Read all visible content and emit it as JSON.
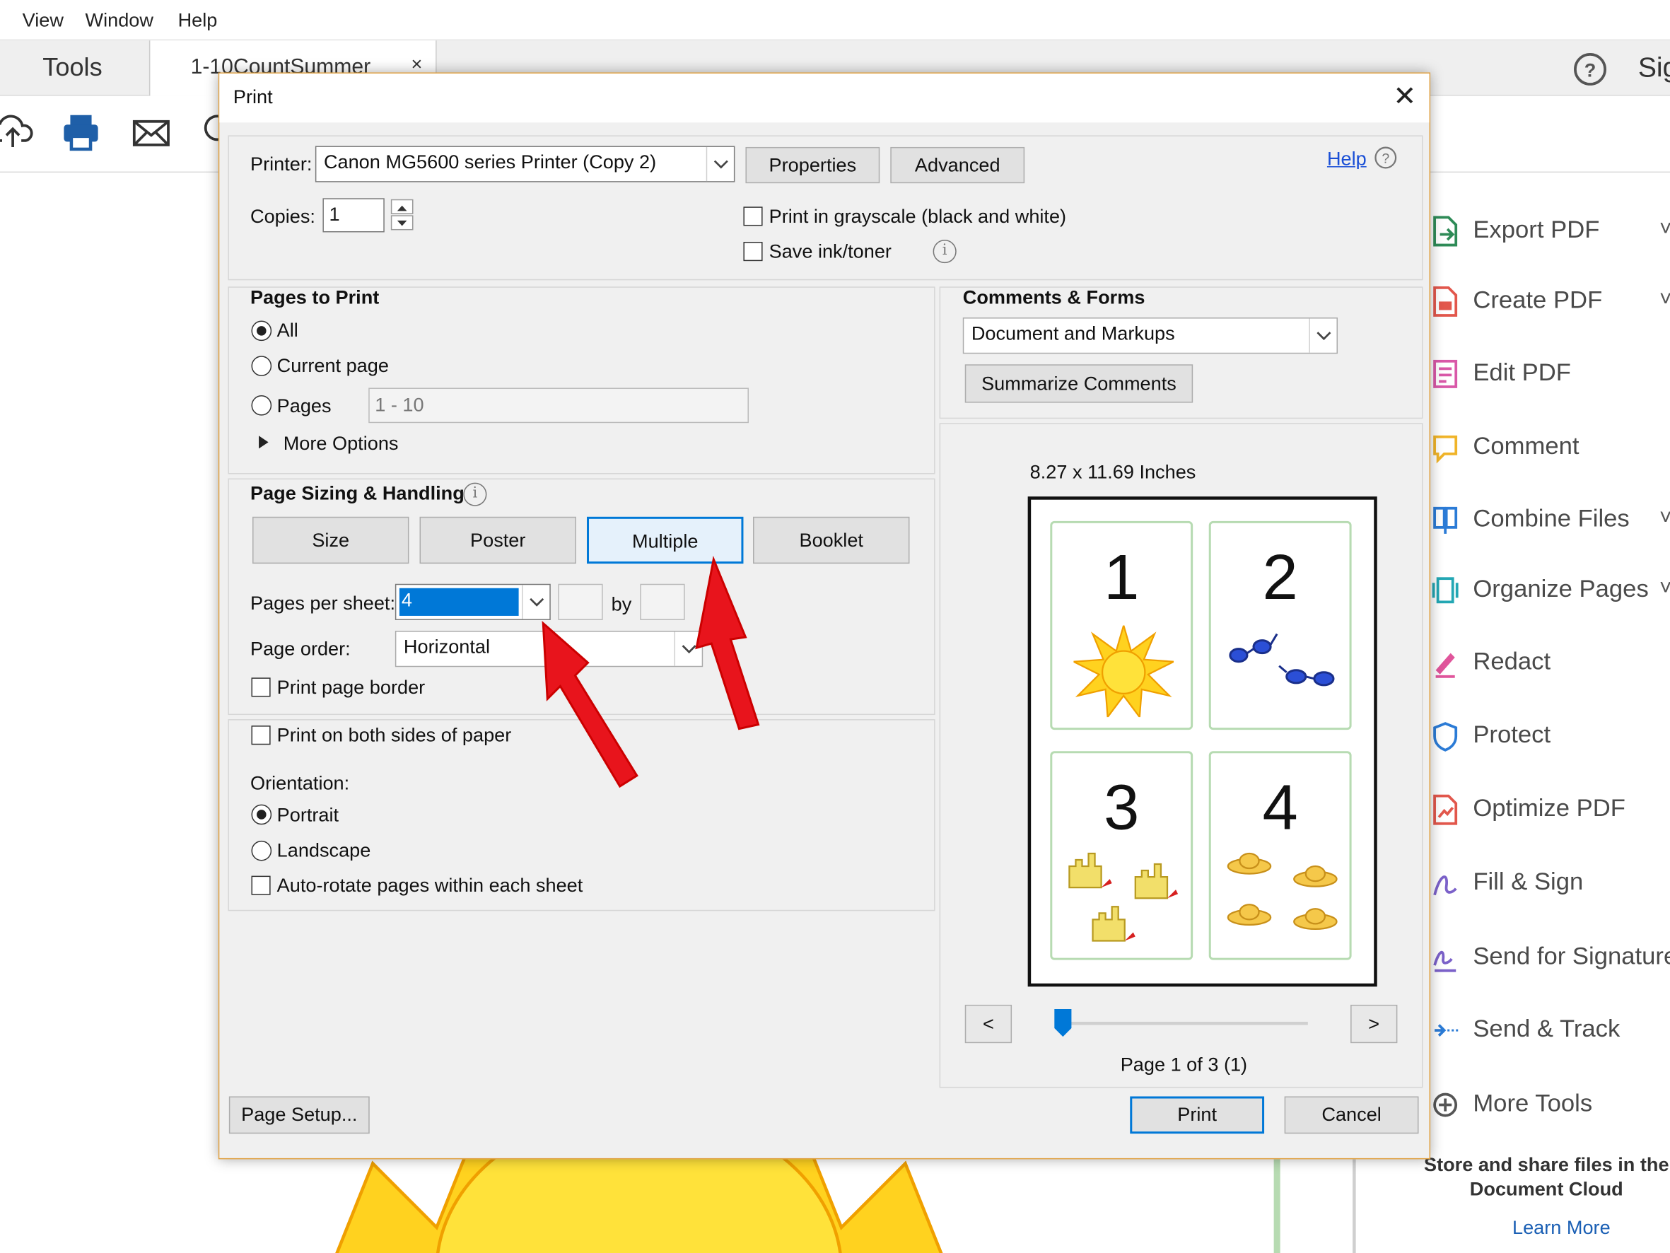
{
  "menubar": {
    "items": [
      "View",
      "Window",
      "Help"
    ]
  },
  "tabs": {
    "tools": "Tools",
    "document": "1-10CountSummer",
    "close": "×",
    "sign": "Sig"
  },
  "right_pane": {
    "items": [
      {
        "label": "Export PDF",
        "icon": "export-pdf-icon",
        "color": "#2e8b57",
        "chevron": "˅"
      },
      {
        "label": "Create PDF",
        "icon": "create-pdf-icon",
        "color": "#e2574c",
        "chevron": "˅"
      },
      {
        "label": "Edit PDF",
        "icon": "edit-pdf-icon",
        "color": "#d958a8",
        "chevron": ""
      },
      {
        "label": "Comment",
        "icon": "comment-icon",
        "color": "#f0b429",
        "chevron": ""
      },
      {
        "label": "Combine Files",
        "icon": "combine-files-icon",
        "color": "#2b7bd6",
        "chevron": "˅"
      },
      {
        "label": "Organize Pages",
        "icon": "organize-pages-icon",
        "color": "#23a7b4",
        "chevron": "˅"
      },
      {
        "label": "Redact",
        "icon": "redact-icon",
        "color": "#e0559b",
        "chevron": ""
      },
      {
        "label": "Protect",
        "icon": "protect-icon",
        "color": "#2b7bd6",
        "chevron": ""
      },
      {
        "label": "Optimize PDF",
        "icon": "optimize-pdf-icon",
        "color": "#e2574c",
        "chevron": ""
      },
      {
        "label": "Fill & Sign",
        "icon": "fill-sign-icon",
        "color": "#7b61c9",
        "chevron": ""
      },
      {
        "label": "Send for Signature",
        "icon": "send-signature-icon",
        "color": "#7b61c9",
        "chevron": ""
      },
      {
        "label": "Send & Track",
        "icon": "send-track-icon",
        "color": "#2b7bd6",
        "chevron": ""
      },
      {
        "label": "More Tools",
        "icon": "more-tools-icon",
        "color": "#555555",
        "chevron": ""
      }
    ],
    "store_text": "Store and share files in the Document Cloud",
    "learn_more": "Learn More"
  },
  "dialog": {
    "title": "Print",
    "close": "✕",
    "printer_label": "Printer:",
    "printer_value": "Canon MG5600 series Printer (Copy 2)",
    "properties": "Properties",
    "advanced": "Advanced",
    "help": "Help",
    "copies_label": "Copies:",
    "copies_value": "1",
    "grayscale": {
      "label": "Print in grayscale (black and white)",
      "checked": false
    },
    "save_ink": {
      "label": "Save ink/toner",
      "checked": false
    },
    "pages_to_print": {
      "title": "Pages to Print",
      "all": "All",
      "current": "Current page",
      "pages": "Pages",
      "pages_range": "1 - 10",
      "more_options": "More Options",
      "selected": "All"
    },
    "page_sizing": {
      "title": "Page Sizing & Handling",
      "buttons": [
        "Size",
        "Poster",
        "Multiple",
        "Booklet"
      ],
      "active": "Multiple",
      "pages_per_sheet_label": "Pages per sheet:",
      "pages_per_sheet_value": "4",
      "by": "by",
      "page_order_label": "Page order:",
      "page_order_value": "Horizontal",
      "border": "Print page border"
    },
    "both_sides": "Print on both sides of paper",
    "orientation": {
      "label": "Orientation:",
      "portrait": "Portrait",
      "landscape": "Landscape",
      "auto_rotate": "Auto-rotate pages within each sheet",
      "selected": "Portrait"
    },
    "comments_forms": {
      "title": "Comments & Forms",
      "value": "Document and Markups",
      "summarize": "Summarize Comments"
    },
    "preview": {
      "size": "8.27 x 11.69 Inches",
      "cards": [
        "1",
        "2",
        "3",
        "4"
      ],
      "prev": "<",
      "next": ">",
      "page_info": "Page 1 of 3 (1)"
    },
    "page_setup": "Page Setup...",
    "print": "Print",
    "cancel": "Cancel"
  },
  "colors": {
    "accent": "#0078d7",
    "arrow": "#e8141c",
    "link": "#1a5fb4",
    "sun": "#ffd21f"
  }
}
